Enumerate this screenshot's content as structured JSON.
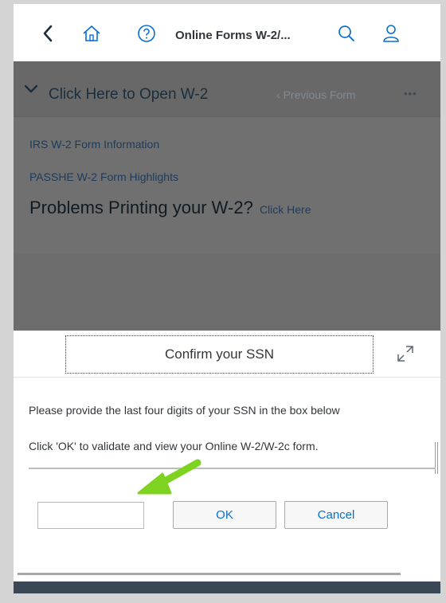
{
  "header": {
    "title": "Online Forms W-2/...",
    "icons": [
      "back-icon",
      "home-icon",
      "help-icon",
      "search-icon",
      "user-icon"
    ],
    "accent_color": "#0a6ed1"
  },
  "form_bar": {
    "title": "Click Here to Open W-2",
    "previous_label": "Previous Form",
    "more_label": "•••"
  },
  "content": {
    "link_irs": "IRS W-2 Form Information",
    "link_passhe": "PASSHE W-2 Form Highlights",
    "problems_text": "Problems Printing your W-2?",
    "problems_link": "Click Here"
  },
  "dialog": {
    "title": "Confirm your SSN",
    "message_1": "Please provide the last four digits of your SSN in the box below",
    "message_2": "Click 'OK' to validate and view your Online W-2/W-2c form.",
    "ssn_value": "",
    "ok_label": "OK",
    "cancel_label": "Cancel"
  },
  "annotation": {
    "arrow_color": "#7ed321"
  }
}
